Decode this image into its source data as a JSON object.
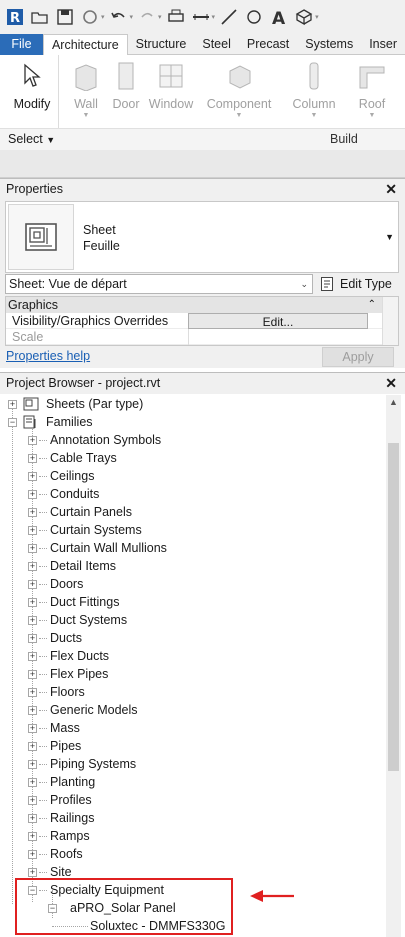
{
  "quick_access": {
    "icons": [
      "revit-logo-icon",
      "open-icon",
      "save-icon",
      "sync-icon",
      "undo-icon",
      "redo-icon",
      "print-icon",
      "measure-icon",
      "dimension-icon",
      "tag-icon",
      "text-icon",
      "3d-view-icon"
    ]
  },
  "tabs": [
    "File",
    "Architecture",
    "Structure",
    "Steel",
    "Precast",
    "Systems",
    "Inser"
  ],
  "active_tab": "Architecture",
  "ribbon": {
    "modify": "Modify",
    "wall": "Wall",
    "door": "Door",
    "window": "Window",
    "component": "Component",
    "column": "Column",
    "roof": "Roof",
    "select": "Select",
    "build": "Build"
  },
  "properties": {
    "title": "Properties",
    "type_line1": "Sheet",
    "type_line2": "Feuille",
    "instance": "Sheet: Vue de départ",
    "edit_type": "Edit Type",
    "group": "Graphics",
    "row1_key": "Visibility/Graphics Overrides",
    "row1_value": "Edit...",
    "row2_key": "Scale",
    "help": "Properties help",
    "apply": "Apply"
  },
  "project_browser": {
    "title": "Project Browser - project.rvt",
    "sheets": "Sheets (Par type)",
    "families": "Families",
    "categories": [
      "Annotation Symbols",
      "Cable Trays",
      "Ceilings",
      "Conduits",
      "Curtain Panels",
      "Curtain Systems",
      "Curtain Wall Mullions",
      "Detail Items",
      "Doors",
      "Duct Fittings",
      "Duct Systems",
      "Ducts",
      "Flex Ducts",
      "Flex Pipes",
      "Floors",
      "Generic Models",
      "Mass",
      "Pipes",
      "Piping Systems",
      "Planting",
      "Profiles",
      "Railings",
      "Ramps",
      "Roofs",
      "Site",
      "Specialty Equipment"
    ],
    "family": "aPRO_Solar Panel",
    "type": "Soluxtec - DMMFS330G"
  },
  "colors": {
    "file_tab": "#2b6cb8",
    "highlight": "#e02020",
    "link": "#1a5fb4"
  }
}
